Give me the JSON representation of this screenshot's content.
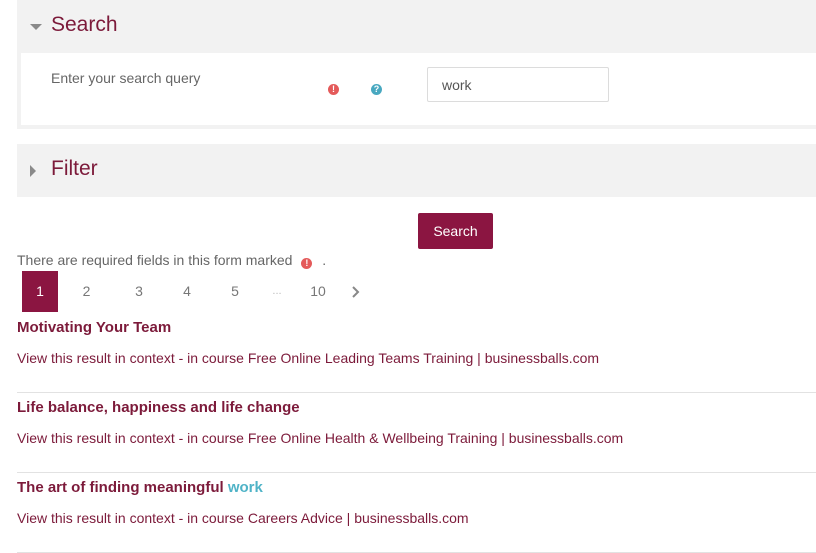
{
  "search_section": {
    "legend": "Search",
    "query_label": "Enter your search query",
    "query_value": "work"
  },
  "filter_section": {
    "legend": "Filter"
  },
  "submit_label": "Search",
  "required_note": "There are required fields in this form marked",
  "required_note_suffix": ".",
  "pagination": {
    "pages": [
      "1",
      "2",
      "3",
      "4",
      "5",
      "...",
      "10"
    ],
    "current": "1"
  },
  "results": [
    {
      "title": "Motivating Your Team",
      "title_highlight": "",
      "context": "View this result in context - in course Free Online Leading Teams Training | businessballs.com"
    },
    {
      "title": "Life balance, happiness and life change",
      "title_highlight": "",
      "context": "View this result in context - in course Free Online Health & Wellbeing Training | businessballs.com"
    },
    {
      "title": "The art of finding meaningful",
      "title_highlight": "work",
      "context": "View this result in context - in course Careers Advice | businessballs.com"
    }
  ],
  "colors": {
    "accent": "#8b1541",
    "heading": "#7c1a3a",
    "highlight": "#4fb3c7",
    "required_icon": "#e45a5a",
    "help_icon": "#48a8c0"
  },
  "icons": [
    "caret-down-icon",
    "caret-right-icon",
    "required-icon",
    "help-icon",
    "chevron-right-icon"
  ]
}
